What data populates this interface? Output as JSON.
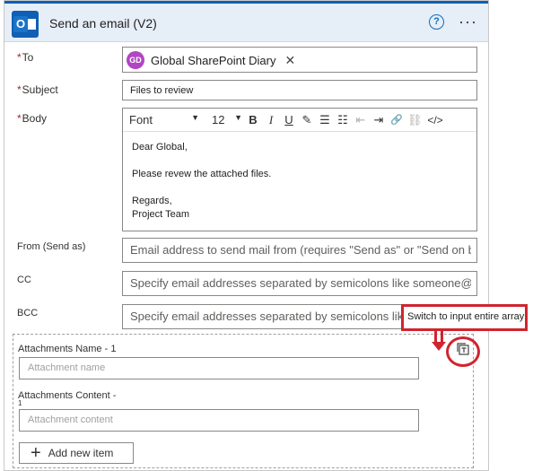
{
  "header": {
    "title": "Send an email (V2)",
    "help_icon": "?",
    "more_icon": "···"
  },
  "fields": {
    "to": {
      "label": "To",
      "required": "*",
      "token": {
        "initials": "GD",
        "name": "Global SharePoint Diary",
        "remove": "✕"
      }
    },
    "subject": {
      "label": "Subject",
      "required": "*",
      "value": "Files to review"
    },
    "body": {
      "label": "Body",
      "required": "*",
      "toolbar": {
        "font": "Font",
        "font_caret": "▼",
        "size": "12",
        "size_caret": "▼",
        "bold": "B",
        "italic": "I",
        "underline": "U",
        "highlight": "✎",
        "bullets": "☰",
        "numbering": "☷",
        "outdent": "⇤",
        "indent": "⇥",
        "link": "🔗",
        "unlink": "⛓",
        "code": "</>"
      },
      "lines": [
        "Dear Global,",
        "",
        "Please revew the attached files.",
        "",
        "Regards,",
        "Project Team"
      ]
    },
    "from": {
      "label": "From (Send as)",
      "placeholder": "Email address to send mail from (requires \"Send as\" or \"Send on behalf of\" permission)"
    },
    "cc": {
      "label": "CC",
      "placeholder": "Specify email addresses separated by semicolons like someone@contoso.com"
    },
    "bcc": {
      "label": "BCC",
      "placeholder": "Specify email addresses separated by semicolons like someone@contoso.com"
    }
  },
  "attachments": {
    "name_label": "Attachments Name - 1",
    "name_placeholder": "Attachment name",
    "content_label_line1": "Attachments Content -",
    "content_label_line2": "1",
    "content_placeholder": "Attachment content",
    "add_button": "Add new item",
    "add_icon": "+"
  },
  "annotation": {
    "tooltip": "Switch to input entire array",
    "highlight_color": "#d1242f"
  },
  "colors": {
    "accent": "#0f5fb5",
    "required": "#a4262c",
    "avatar": "#b146c2"
  }
}
